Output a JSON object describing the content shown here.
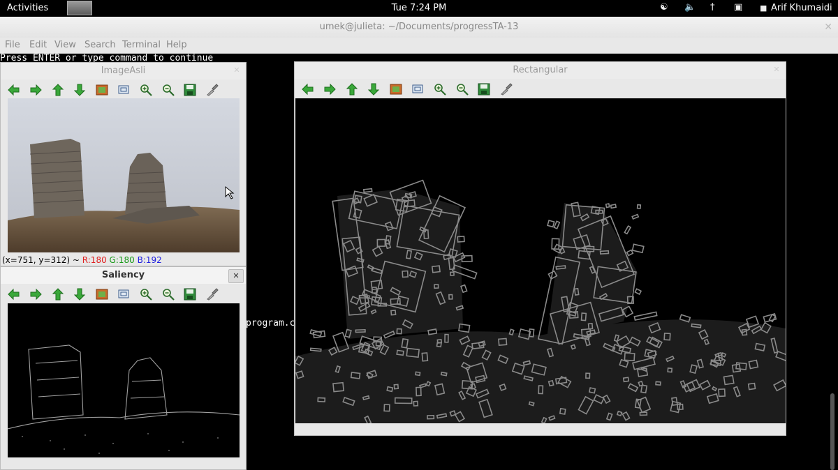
{
  "topbar": {
    "activities": "Activities",
    "clock": "Tue  7:24 PM",
    "user": "Arif Khumaidi"
  },
  "terminal": {
    "title": "umek@julieta: ~/Documents/progressTA-13",
    "menu": [
      "File",
      "Edit",
      "View",
      "Search",
      "Terminal",
      "Help"
    ],
    "line1": "Press ENTER or type command to continue",
    "line2": "program.cp"
  },
  "windows": {
    "image_asli": {
      "title": "ImageAsli",
      "status_prefix": "(x=751, y=312) ~ ",
      "r": "R:180",
      "g": "G:180",
      "b": "B:192"
    },
    "saliency": {
      "title": "Saliency"
    },
    "rectangular": {
      "title": "Rectangular"
    }
  },
  "toolbar_icons": [
    "arrow-left-icon",
    "arrow-right-icon",
    "arrow-up-icon",
    "arrow-down-icon",
    "image-icon",
    "zoom-fit-icon",
    "zoom-in-icon",
    "zoom-out-icon",
    "save-icon",
    "properties-icon"
  ],
  "colors": {
    "red": "#e02020",
    "green": "#1a9a1a",
    "blue": "#2020e0"
  }
}
